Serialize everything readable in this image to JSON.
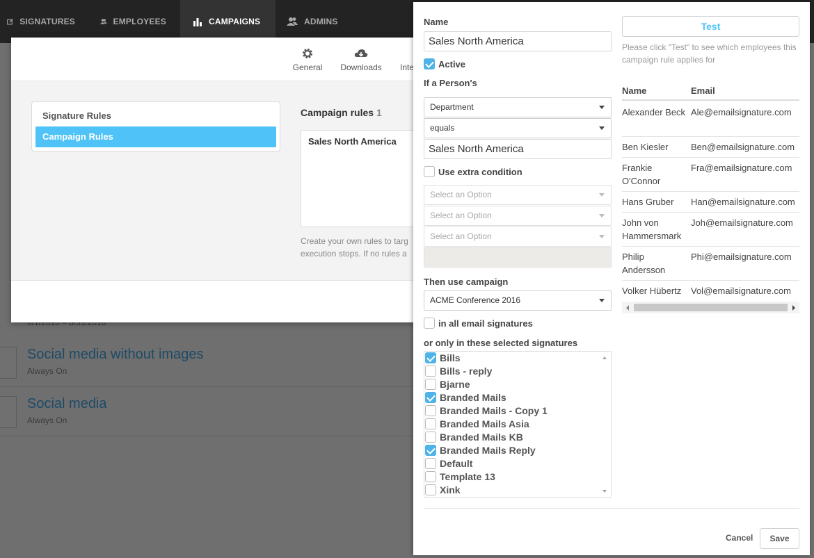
{
  "nav": {
    "items": [
      {
        "label": "SIGNATURES",
        "icon": "edit-icon"
      },
      {
        "label": "EMPLOYEES",
        "icon": "users-icon"
      },
      {
        "label": "CAMPAIGNS",
        "icon": "bar-chart-icon"
      },
      {
        "label": "ADMINS",
        "icon": "admin-users-icon"
      }
    ],
    "active": "CAMPAIGNS"
  },
  "background": {
    "dates": "6/1/2016 – 8/31/2016",
    "campaigns": [
      {
        "title": "Social media without images",
        "sub": "Always On"
      },
      {
        "title": "Social media",
        "sub": "Always On"
      }
    ]
  },
  "settings_modal": {
    "tabs": [
      "General",
      "Downloads",
      "Inte"
    ],
    "rule_menu": [
      "Signature Rules",
      "Campaign Rules"
    ],
    "campaign_rules_heading": "Campaign rules",
    "campaign_rules_count": "1",
    "campaign_rule_item": "Sales North America",
    "description_line1": "Create your own rules to targ",
    "description_line2": "execution stops. If no rules a"
  },
  "panel": {
    "name_label": "Name",
    "name_value": "Sales North America",
    "active_label": "Active",
    "active_checked": true,
    "if_person_label": "If a Person's",
    "field_select": "Department",
    "operator_select": "equals",
    "condition_value": "Sales North America",
    "extra_condition_label": "Use extra condition",
    "extra_condition_checked": false,
    "extra_placeholder": "Select an Option",
    "then_use_label": "Then use campaign",
    "campaign_select": "ACME Conference 2016",
    "all_signatures_label": "in all email signatures",
    "all_signatures_checked": false,
    "selected_signatures_label": "or only in these selected signatures",
    "signatures": [
      {
        "label": "Bills",
        "checked": true
      },
      {
        "label": "Bills - reply",
        "checked": false
      },
      {
        "label": "Bjarne",
        "checked": false
      },
      {
        "label": "Branded Mails",
        "checked": true
      },
      {
        "label": "Branded Mails - Copy 1",
        "checked": false
      },
      {
        "label": "Branded Mails Asia",
        "checked": false
      },
      {
        "label": "Branded Mails KB",
        "checked": false
      },
      {
        "label": "Branded Mails Reply",
        "checked": true
      },
      {
        "label": "Default",
        "checked": false
      },
      {
        "label": "Template 13",
        "checked": false
      },
      {
        "label": "Xink",
        "checked": false
      }
    ],
    "test_button": "Test",
    "test_hint": "Please click \"Test\" to see which employees this campaign rule applies for",
    "table": {
      "headers": [
        "Name",
        "Email"
      ],
      "rows": [
        {
          "name": "Alexander Beck",
          "email": "Ale@emailsignature.com"
        },
        {
          "name": "Ben Kiesler",
          "email": "Ben@emailsignature.com"
        },
        {
          "name": "Frankie O'Connor",
          "email": "Fra@emailsignature.com"
        },
        {
          "name": "Hans Gruber",
          "email": "Han@emailsignature.com"
        },
        {
          "name": "John von Hammersmark",
          "email": "Joh@emailsignature.com"
        },
        {
          "name": "Philip Andersson",
          "email": "Phi@emailsignature.com"
        },
        {
          "name": "Volker Hübertz",
          "email": "Vol@emailsignature.com"
        }
      ]
    },
    "cancel_label": "Cancel",
    "save_label": "Save"
  }
}
